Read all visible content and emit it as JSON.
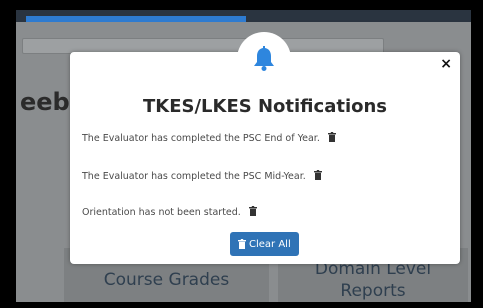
{
  "background": {
    "heading_fragment": "eeb",
    "tiles": [
      {
        "label": "Course Grades"
      },
      {
        "label": "Domain Level",
        "label2": "Reports"
      }
    ]
  },
  "modal": {
    "title": "TKES/LKES Notifications",
    "close_label": "×",
    "notifications": [
      {
        "text": "The Evaluator has completed the PSC End of Year."
      },
      {
        "text": "The Evaluator has completed the PSC Mid-Year."
      },
      {
        "text": "Orientation has not been started."
      }
    ],
    "clear_all_label": "Clear All",
    "icons": {
      "header": "bell-icon",
      "delete": "trash-icon",
      "close": "close-icon"
    },
    "colors": {
      "accent": "#2f73b6",
      "bell": "#2e86de"
    }
  }
}
